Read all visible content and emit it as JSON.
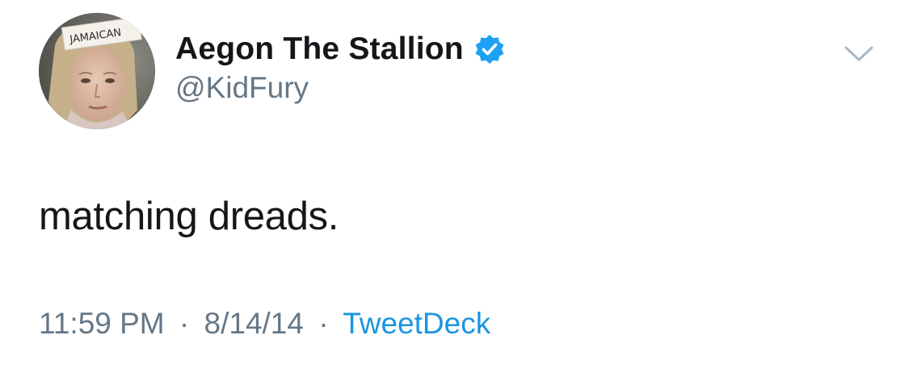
{
  "author": {
    "display_name": "Aegon The Stallion",
    "handle": "@KidFury",
    "verified": true,
    "avatar_sign": "JAMAICAN"
  },
  "tweet": {
    "text": "matching dreads."
  },
  "meta": {
    "time": "11:59 PM",
    "date": "8/14/14",
    "separator": "·",
    "source": "TweetDeck"
  },
  "icons": {
    "verified": "verified-badge-icon",
    "menu": "chevron-down-icon"
  },
  "colors": {
    "text_primary": "#14171a",
    "text_secondary": "#657786",
    "link": "#1b95e0",
    "verified": "#1da1f2",
    "caret": "#aab8c2"
  }
}
